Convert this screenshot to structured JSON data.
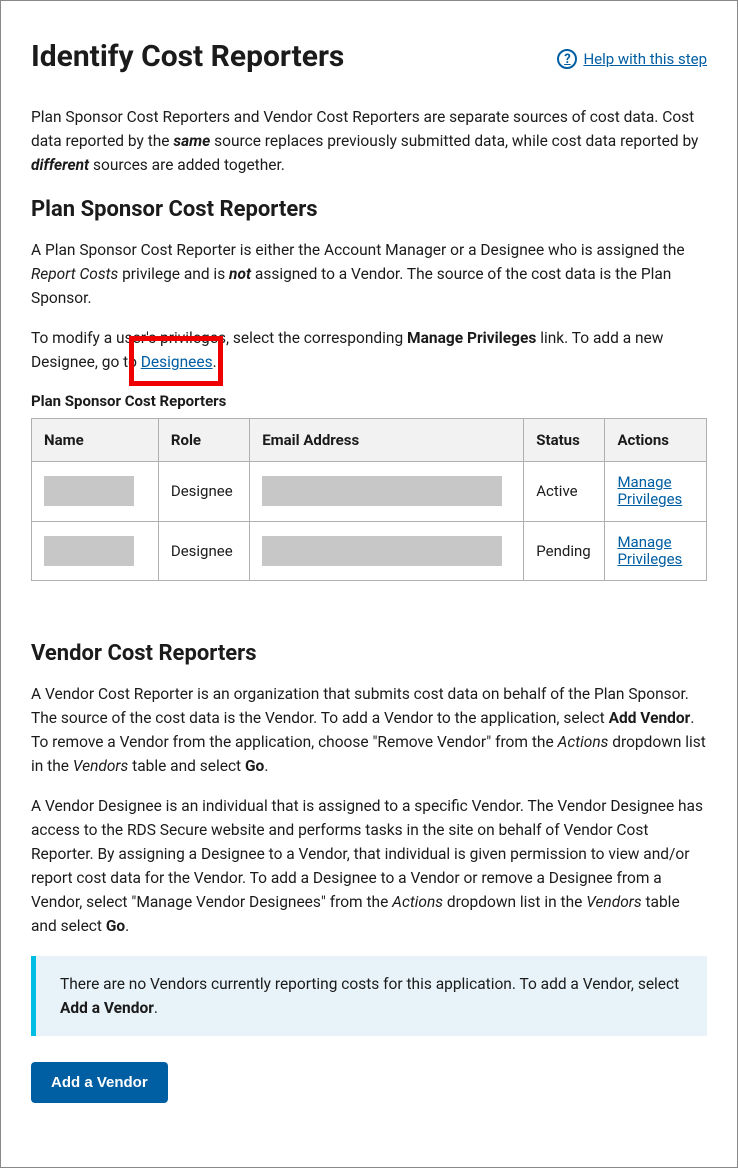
{
  "header": {
    "title": "Identify Cost Reporters",
    "help_label": " Help with this step"
  },
  "intro": {
    "p1a": "Plan Sponsor Cost Reporters and Vendor Cost Reporters are separate sources of cost data. Cost data reported by the ",
    "same": "same",
    "p1b": " source replaces previously submitted data, while cost data reported by ",
    "different": "different",
    "p1c": " sources are added together."
  },
  "plan_sponsor": {
    "heading": "Plan Sponsor Cost Reporters",
    "p1a": "A Plan Sponsor Cost Reporter is either the Account Manager or a Designee who is assigned the ",
    "report_costs": "Report Costs",
    "p1b": " privilege and is ",
    "not": "not",
    "p1c": " assigned to a Vendor. The source of the cost data is the Plan Sponsor.",
    "p2a": "To modify a user's privileges, select the corresponding ",
    "manage_privileges": "Manage Privileges",
    "p2b": " link. To add a new Designee, go to ",
    "designees_link": "Designees",
    "p2c": ".",
    "table_caption": "Plan Sponsor Cost Reporters",
    "cols": {
      "name": "Name",
      "role": "Role",
      "email": "Email Address",
      "status": "Status",
      "actions": "Actions"
    },
    "rows": [
      {
        "role": "Designee",
        "status": "Active",
        "action_l1": "Manage",
        "action_l2": "Privileges"
      },
      {
        "role": "Designee",
        "status": "Pending",
        "action_l1": "Manage",
        "action_l2": "Privileges"
      }
    ]
  },
  "vendor": {
    "heading": "Vendor Cost Reporters",
    "p1a": "A Vendor Cost Reporter is an organization that submits cost data on behalf of the Plan Sponsor. The source of the cost data is the Vendor. To add a Vendor to the application, select ",
    "add_vendor_b": "Add Vendor",
    "p1b": ". To remove a Vendor from the application, choose \"Remove Vendor\" from the ",
    "actions_i": "Actions",
    "p1c": " dropdown list in the ",
    "vendors_i": "Vendors",
    "p1d": " table and select ",
    "go_b": "Go",
    "p1e": ".",
    "p2a": "A Vendor Designee is an individual that is assigned to a specific Vendor. The Vendor Designee has access to the RDS Secure website and performs tasks in the site on behalf of Vendor Cost Reporter. By assigning a Designee to a Vendor, that individual is given permission to view and/or report cost data for the Vendor. To add a Designee to a Vendor or remove a Designee from a Vendor, select \"Manage Vendor Designees\" from the ",
    "p2b": " dropdown list in the ",
    "p2c": " table and select ",
    "p2d": ".",
    "info_a": "There are no Vendors currently reporting costs for this application. To add a Vendor, select ",
    "info_b": "Add a Vendor",
    "info_c": ".",
    "button": "Add a Vendor"
  }
}
